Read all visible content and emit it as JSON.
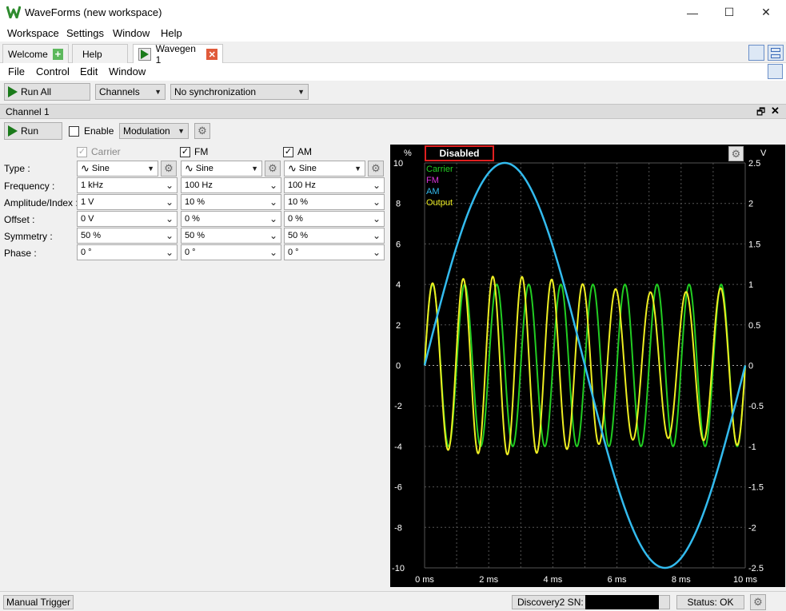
{
  "window": {
    "title": "WaveForms (new workspace)",
    "controls": {
      "minimize": "—",
      "maximize": "☐",
      "close": "✕"
    }
  },
  "menubar": {
    "items": [
      "Workspace",
      "Settings",
      "Window",
      "Help"
    ]
  },
  "tabs": [
    {
      "label": "Welcome"
    },
    {
      "label": "Help"
    },
    {
      "label": "Wavegen 1"
    }
  ],
  "inner_menu": {
    "items": [
      "File",
      "Control",
      "Edit",
      "Window"
    ]
  },
  "toolbar": {
    "run_all_label": "Run All",
    "channels_value": "Channels",
    "sync_value": "No synchronization"
  },
  "channel": {
    "title": "Channel 1",
    "run_label": "Run",
    "enable_label": "Enable",
    "mode_value": "Modulation",
    "columns": [
      {
        "name": "Carrier",
        "checked": true,
        "disabled": true
      },
      {
        "name": "FM",
        "checked": true,
        "disabled": false
      },
      {
        "name": "AM",
        "checked": true,
        "disabled": false
      }
    ],
    "row_labels": [
      "Type :",
      "Frequency :",
      "Amplitude/Index :",
      "Offset :",
      "Symmetry :",
      "Phase :"
    ],
    "values": [
      [
        "Sine",
        "Sine",
        "Sine"
      ],
      [
        "1 kHz",
        "100 Hz",
        "100 Hz"
      ],
      [
        "1 V",
        "10 %",
        "10 %"
      ],
      [
        "0 V",
        "0 %",
        "0 %"
      ],
      [
        "50 %",
        "50 %",
        "50 %"
      ],
      [
        "0 °",
        "0 °",
        "0 °"
      ]
    ]
  },
  "plot": {
    "status": "Disabled",
    "left_unit": "%",
    "right_unit": "V",
    "legend": [
      {
        "name": "Carrier",
        "color": "#22cc22"
      },
      {
        "name": "FM",
        "color": "#dd33dd"
      },
      {
        "name": "AM",
        "color": "#33bbee"
      },
      {
        "name": "Output",
        "color": "#eeee22"
      }
    ]
  },
  "chart_data": {
    "type": "line",
    "title": "",
    "xlabel": "",
    "ylabel_left": "%",
    "ylabel_right": "V",
    "x_ticks": [
      "0 ms",
      "2 ms",
      "4 ms",
      "6 ms",
      "8 ms",
      "10 ms"
    ],
    "y_left_ticks": [
      "10",
      "8",
      "6",
      "4",
      "2",
      "0",
      "-2",
      "-4",
      "-6",
      "-8",
      "-10"
    ],
    "y_right_ticks": [
      "2.5",
      "2",
      "1.5",
      "1",
      "0.5",
      "0",
      "-0.5",
      "-1",
      "-1.5",
      "-2",
      "-2.5"
    ],
    "xlim": [
      0,
      10
    ],
    "ylim_left": [
      -10,
      10
    ],
    "ylim_right": [
      -2.5,
      2.5
    ],
    "grid": true,
    "series": [
      {
        "name": "Carrier",
        "color": "#22cc22",
        "kind": "sine",
        "frequency_hz": 1000,
        "amplitude_v": 1
      },
      {
        "name": "AM",
        "color": "#33bbee",
        "kind": "sine",
        "frequency_hz": 100,
        "amplitude_pct": 10
      },
      {
        "name": "Output",
        "color": "#eeee22",
        "kind": "fm-am",
        "carrier_hz": 1000,
        "fm_hz": 100,
        "fm_index_pct": 10,
        "am_hz": 100,
        "am_depth_pct": 10
      }
    ]
  },
  "statusbar": {
    "manual_trigger": "Manual Trigger",
    "device": "Discovery2 SN:",
    "status": "Status: OK"
  }
}
